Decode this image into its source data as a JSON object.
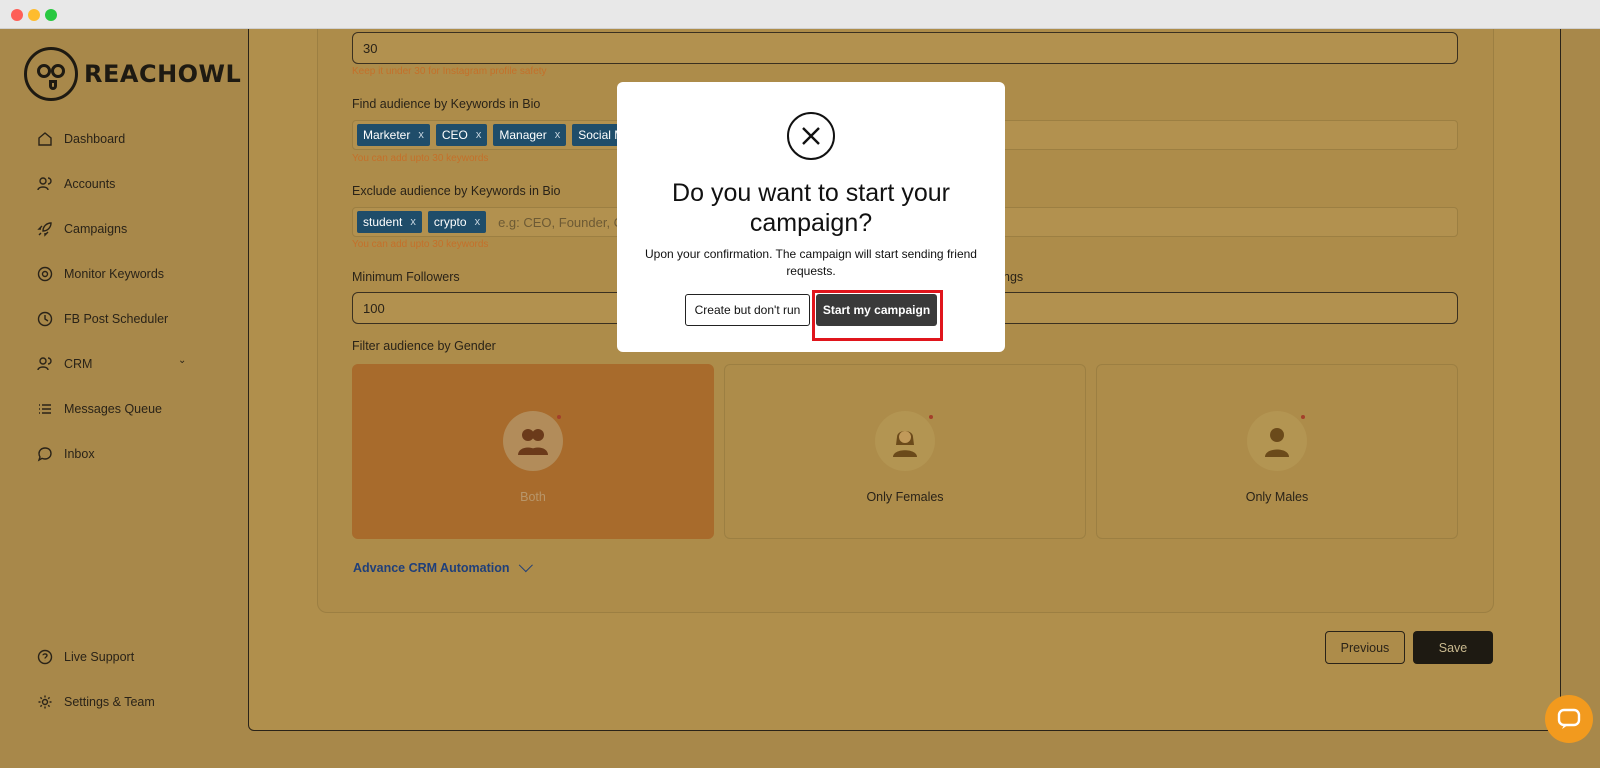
{
  "window": {
    "title": ""
  },
  "brand": {
    "name": "REACHOWL"
  },
  "sidebar": {
    "items": [
      {
        "label": "Dashboard",
        "icon": "home-icon"
      },
      {
        "label": "Accounts",
        "icon": "users-icon"
      },
      {
        "label": "Campaigns",
        "icon": "rocket-icon"
      },
      {
        "label": "Monitor Keywords",
        "icon": "at-icon"
      },
      {
        "label": "FB Post Scheduler",
        "icon": "clock-icon"
      },
      {
        "label": "CRM",
        "icon": "users-icon"
      },
      {
        "label": "Messages Queue",
        "icon": "list-icon"
      },
      {
        "label": "Inbox",
        "icon": "chat-icon"
      }
    ],
    "footer": [
      {
        "label": "Live Support",
        "icon": "help-icon"
      },
      {
        "label": "Settings & Team",
        "icon": "gear-icon"
      }
    ]
  },
  "form": {
    "daily_limit": {
      "value": "30",
      "helper": "Keep it under 30 for Instagram profile safety"
    },
    "include_keywords": {
      "label": "Find audience by Keywords in Bio",
      "tags": [
        "Marketer",
        "CEO",
        "Manager",
        "Social Me"
      ],
      "helper": "You can add upto 30 keywords"
    },
    "exclude_keywords": {
      "label": "Exclude audience by Keywords in Bio",
      "tags": [
        "student",
        "crypto"
      ],
      "placeholder": "e.g: CEO, Founder, Co",
      "helper": "You can add upto 30 keywords"
    },
    "min_followers": {
      "label": "Minimum Followers",
      "value": "100"
    },
    "second_field_label_fragment": "ngs",
    "gender": {
      "label": "Filter audience by Gender",
      "options": [
        "Both",
        "Only Females",
        "Only Males"
      ],
      "selected": "Both"
    },
    "advanced_link": "Advance CRM Automation"
  },
  "actions": {
    "previous": "Previous",
    "save": "Save"
  },
  "modal": {
    "title": "Do you want to start your campaign?",
    "body": "Upon your confirmation. The campaign will start sending friend requests.",
    "secondary": "Create but don't run",
    "primary": "Start my campaign"
  },
  "colors": {
    "accent": "#f29a1e",
    "tag": "#1f4d6a",
    "highlight": "#e0151c",
    "primary_button": "#3a3a3a"
  }
}
